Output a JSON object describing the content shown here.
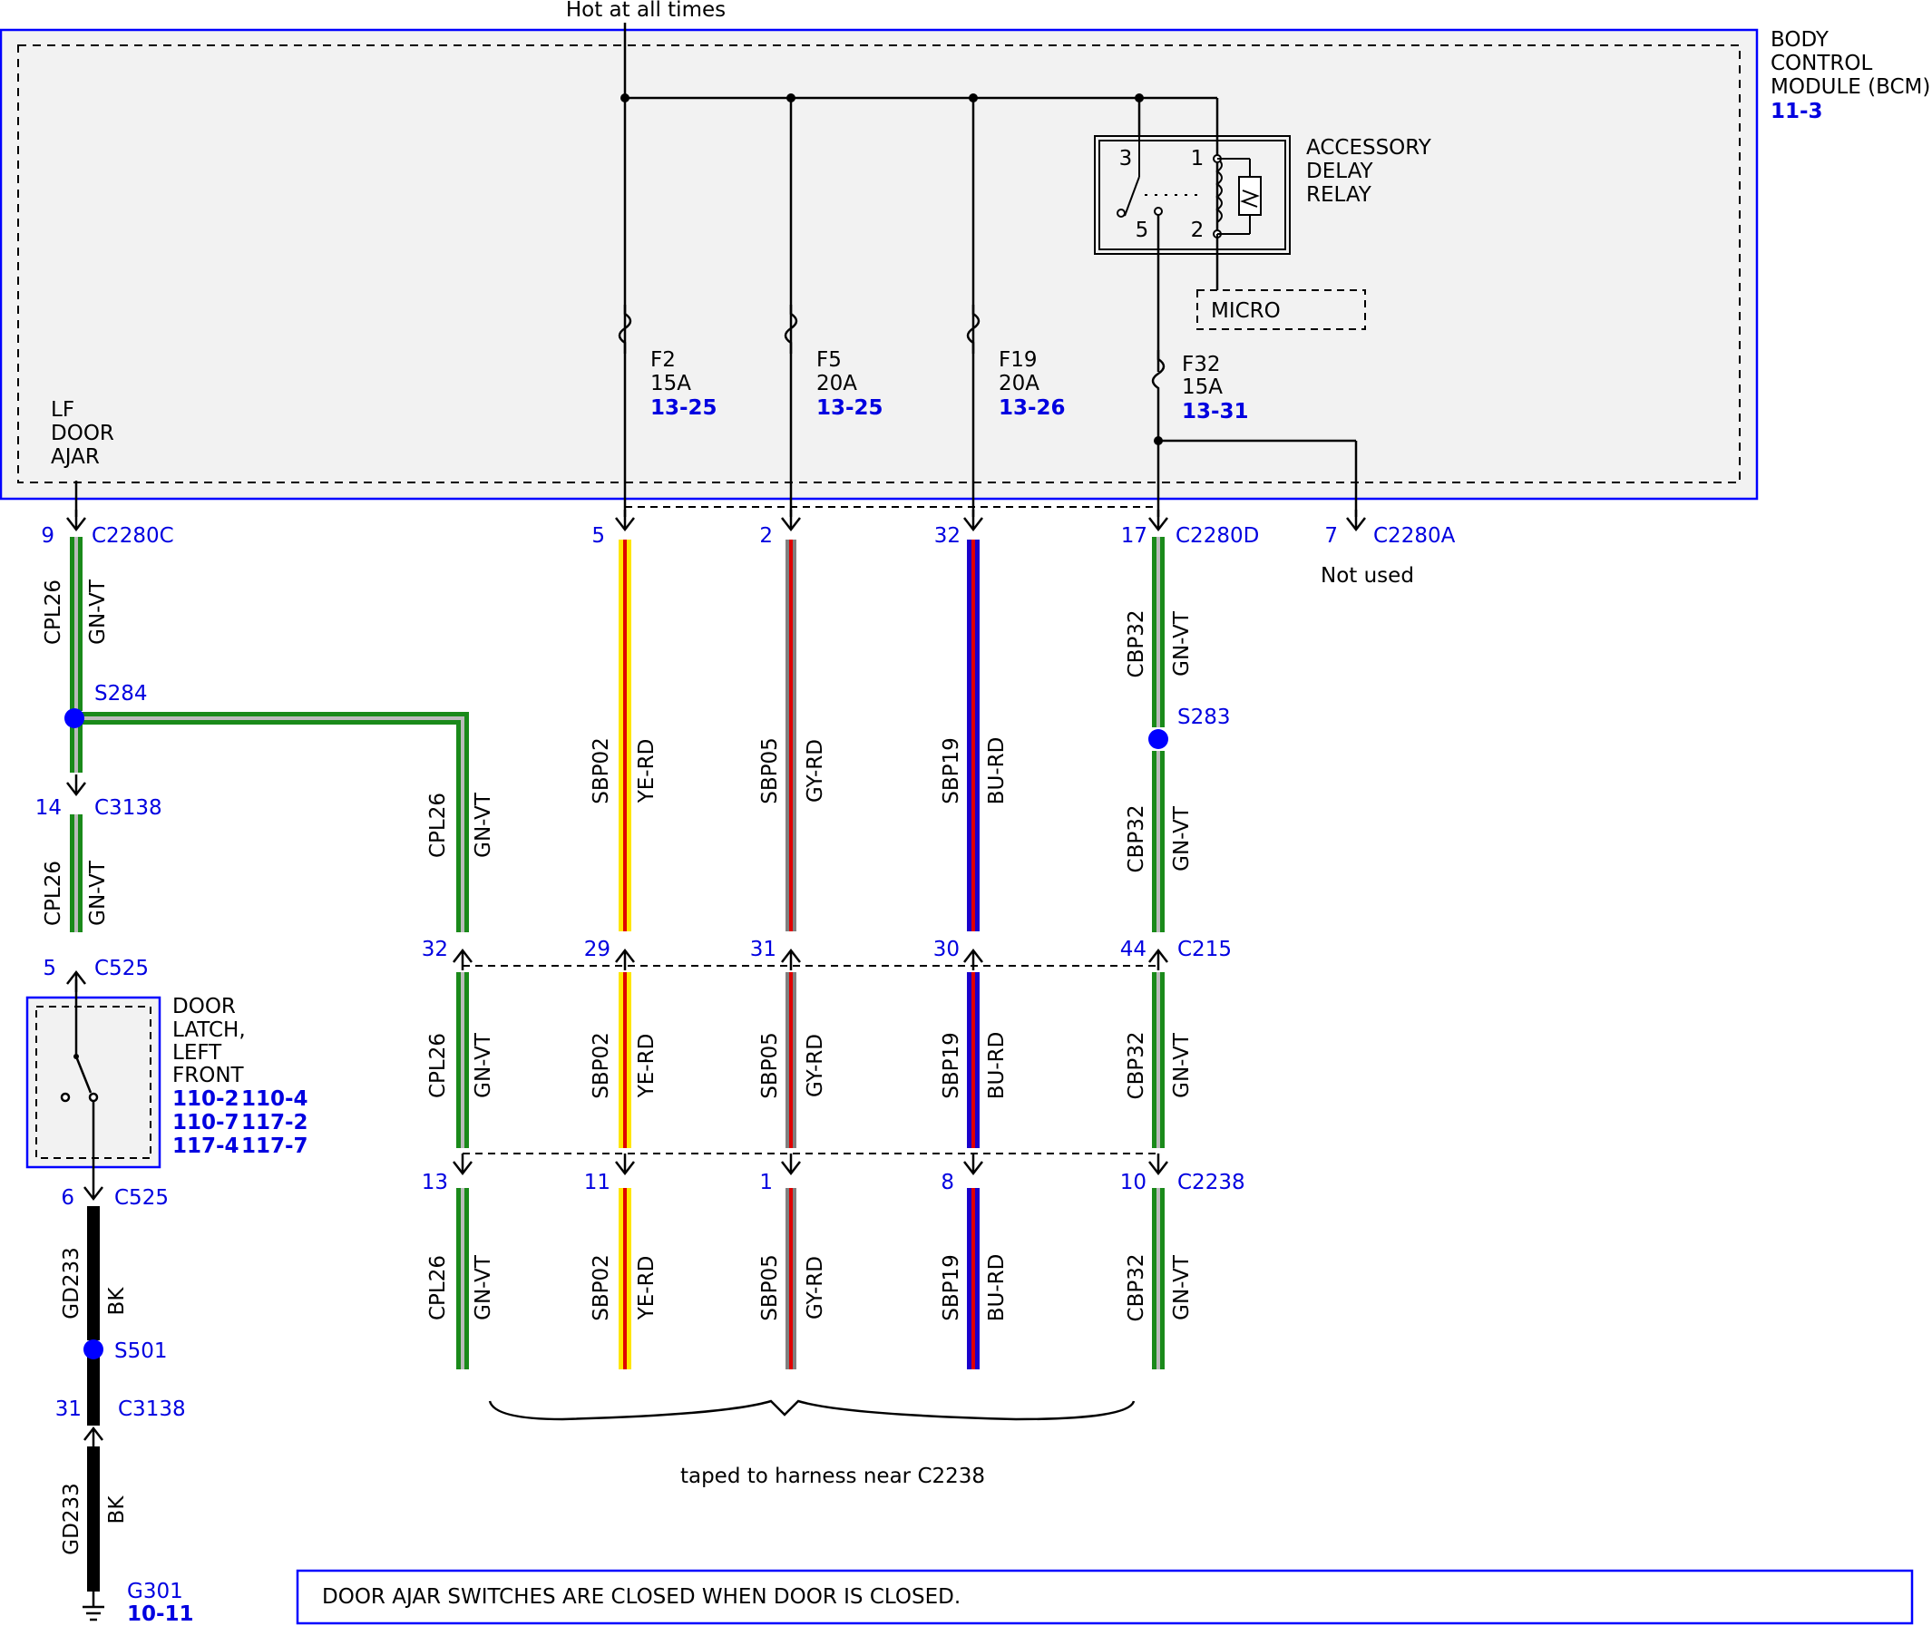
{
  "colors": {
    "blue": "#0000ff",
    "link": "#0000e0",
    "module_fill": "#f2f2f2",
    "green": "#1a8a1a",
    "yellow": "#ffe600",
    "red": "#e00000",
    "gray": "#808080",
    "wire_blue": "#1a00cc",
    "black": "#000000"
  },
  "power": {
    "label": "Hot at all times"
  },
  "bcm": {
    "line1": "BODY",
    "line2": "CONTROL",
    "line3": "MODULE (BCM)",
    "ref": "11-3"
  },
  "lf_door_ajar": {
    "line1": "LF",
    "line2": "DOOR",
    "line3": "AJAR"
  },
  "relay": {
    "line1": "ACCESSORY",
    "line2": "DELAY",
    "line3": "RELAY",
    "pin3": "3",
    "pin1": "1",
    "pin5": "5",
    "pin2": "2",
    "micro": "MICRO"
  },
  "fuses": [
    {
      "name": "F2",
      "rating": "15A",
      "ref": "13-25"
    },
    {
      "name": "F5",
      "rating": "20A",
      "ref": "13-25"
    },
    {
      "name": "F19",
      "rating": "20A",
      "ref": "13-26"
    },
    {
      "name": "F32",
      "rating": "15A",
      "ref": "13-31"
    }
  ],
  "connectors": {
    "c2280c": {
      "pin": "9",
      "name": "C2280C"
    },
    "c2280d": {
      "pins": [
        "5",
        "2",
        "32",
        "17"
      ],
      "name": "C2280D"
    },
    "c2280a": {
      "pin": "7",
      "name": "C2280A",
      "note": "Not used"
    },
    "c3138_top": {
      "pin": "14",
      "name": "C3138"
    },
    "c525_top": {
      "pin": "5",
      "name": "C525"
    },
    "c525_bottom": {
      "pin": "6",
      "name": "C525"
    },
    "c3138_bottom": {
      "pin": "31",
      "name": "C3138"
    },
    "c215": {
      "pins": [
        "32",
        "29",
        "31",
        "30",
        "44"
      ],
      "name": "C215"
    },
    "c2238": {
      "pins": [
        "13",
        "11",
        "1",
        "8",
        "10"
      ],
      "name": "C2238"
    }
  },
  "splices": {
    "s284": "S284",
    "s283": "S283",
    "s501": "S501"
  },
  "wires": {
    "cpl26": {
      "circuit": "CPL26",
      "color": "GN-VT"
    },
    "sbp02": {
      "circuit": "SBP02",
      "color": "YE-RD"
    },
    "sbp05": {
      "circuit": "SBP05",
      "color": "GY-RD"
    },
    "sbp19": {
      "circuit": "SBP19",
      "color": "BU-RD"
    },
    "cbp32": {
      "circuit": "CBP32",
      "color": "GN-VT"
    },
    "gd233": {
      "circuit": "GD233",
      "color": "BK"
    }
  },
  "door_latch": {
    "line1": "DOOR",
    "line2": "LATCH,",
    "line3": "LEFT",
    "line4": "FRONT",
    "refs": [
      "110-2",
      "110-4",
      "110-7",
      "117-2",
      "117-4",
      "117-7"
    ]
  },
  "ground": {
    "name": "G301",
    "ref": "10-11"
  },
  "taped_note": "taped to harness near C2238",
  "note": "DOOR AJAR SWITCHES ARE CLOSED WHEN DOOR IS CLOSED."
}
